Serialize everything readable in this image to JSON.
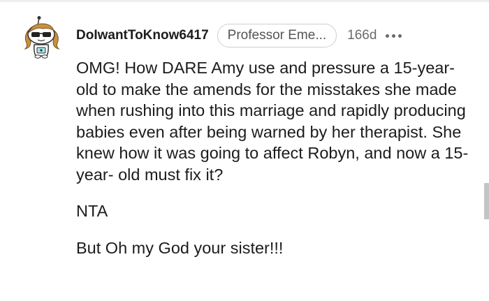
{
  "comment": {
    "username": "DoIwantToKnow6417",
    "flair": "Professor Eme...",
    "timestamp": "166d",
    "paragraphs": [
      "OMG! How DARE Amy use and pressure a 15-year-old to make the amends for the misstakes she made when rushing into this marriage and rapidly producing babies even after being warned by her therapist. She knew how it was going to affect Robyn, and now a 15-year- old must fix it?",
      "NTA",
      "But Oh my God your sister!!!"
    ]
  },
  "colors": {
    "text": "#1c1c1c",
    "meta": "#6a6a6a",
    "flair_border": "#cfcfcf",
    "background": "#ffffff"
  },
  "icons": {
    "avatar": "snoo-avatar-with-sunglasses",
    "more": "more-options-icon"
  }
}
